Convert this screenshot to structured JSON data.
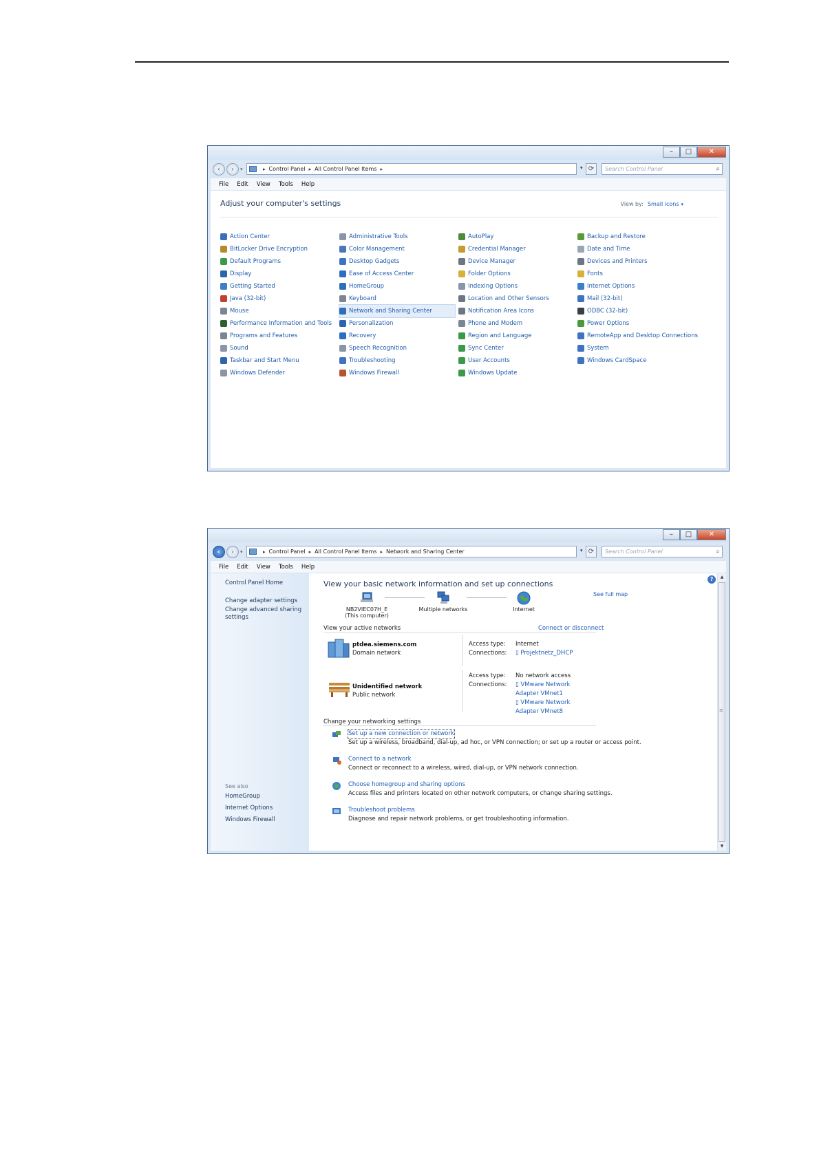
{
  "window1": {
    "title_buttons": [
      "–",
      "□",
      "✕"
    ],
    "nav": {
      "back": "‹",
      "forward": "›",
      "recent": "▾"
    },
    "breadcrumb": [
      "Control Panel",
      "All Control Panel Items"
    ],
    "breadcrumb_arrow": "▸",
    "addr_dropdown": "▾",
    "refresh": "⟳",
    "search_placeholder": "Search Control Panel",
    "search_glyph": "⌕",
    "menu": [
      "File",
      "Edit",
      "View",
      "Tools",
      "Help"
    ],
    "heading": "Adjust your computer's settings",
    "view_by_label": "View by:",
    "view_by_value": "Small icons",
    "view_by_caret": "▾",
    "items": [
      {
        "label": "Action Center",
        "icon": "flag-icon",
        "color": "#3b6fb6"
      },
      {
        "label": "Administrative Tools",
        "icon": "admin-tools-icon",
        "color": "#8a96a8"
      },
      {
        "label": "AutoPlay",
        "icon": "autoplay-icon",
        "color": "#4a8c3a"
      },
      {
        "label": "Backup and Restore",
        "icon": "backup-icon",
        "color": "#5a9a3c"
      },
      {
        "label": "BitLocker Drive Encryption",
        "icon": "bitlocker-icon",
        "color": "#b58a2c"
      },
      {
        "label": "Color Management",
        "icon": "color-management-icon",
        "color": "#4a78b5"
      },
      {
        "label": "Credential Manager",
        "icon": "credential-icon",
        "color": "#c69b2f"
      },
      {
        "label": "Date and Time",
        "icon": "clock-icon",
        "color": "#9aa6b5"
      },
      {
        "label": "Default Programs",
        "icon": "default-programs-icon",
        "color": "#3a9a4a"
      },
      {
        "label": "Desktop Gadgets",
        "icon": "gadgets-icon",
        "color": "#3d73c0"
      },
      {
        "label": "Device Manager",
        "icon": "device-manager-icon",
        "color": "#6d7784"
      },
      {
        "label": "Devices and Printers",
        "icon": "printer-icon",
        "color": "#6d7784"
      },
      {
        "label": "Display",
        "icon": "display-icon",
        "color": "#2d64b0"
      },
      {
        "label": "Ease of Access Center",
        "icon": "ease-of-access-icon",
        "color": "#2d6ec4"
      },
      {
        "label": "Folder Options",
        "icon": "folder-icon",
        "color": "#d8b13a"
      },
      {
        "label": "Fonts",
        "icon": "fonts-icon",
        "color": "#d8b13a"
      },
      {
        "label": "Getting Started",
        "icon": "getting-started-icon",
        "color": "#3d7fc9"
      },
      {
        "label": "HomeGroup",
        "icon": "homegroup-icon",
        "color": "#2e6fba"
      },
      {
        "label": "Indexing Options",
        "icon": "indexing-icon",
        "color": "#8a96a8"
      },
      {
        "label": "Internet Options",
        "icon": "internet-options-icon",
        "color": "#3a7fc8"
      },
      {
        "label": "Java (32-bit)",
        "icon": "java-icon",
        "color": "#c2412e"
      },
      {
        "label": "Keyboard",
        "icon": "keyboard-icon",
        "color": "#7b8593"
      },
      {
        "label": "Location and Other Sensors",
        "icon": "sensors-icon",
        "color": "#6d7784"
      },
      {
        "label": "Mail (32-bit)",
        "icon": "mail-icon",
        "color": "#3d73c0"
      },
      {
        "label": "Mouse",
        "icon": "mouse-icon",
        "color": "#7b8593"
      },
      {
        "label": "Network and Sharing Center",
        "icon": "network-icon",
        "color": "#2f6fb9"
      },
      {
        "label": "Notification Area Icons",
        "icon": "notification-icon",
        "color": "#6d7784"
      },
      {
        "label": "ODBC (32-bit)",
        "icon": "odbc-icon",
        "color": "#3a3f47"
      },
      {
        "label": "Performance Information and Tools",
        "icon": "performance-icon",
        "color": "#2e5f2e"
      },
      {
        "label": "Personalization",
        "icon": "personalization-icon",
        "color": "#2d64b0"
      },
      {
        "label": "Phone and Modem",
        "icon": "phone-icon",
        "color": "#7b8593"
      },
      {
        "label": "Power Options",
        "icon": "power-icon",
        "color": "#4a9a3c"
      },
      {
        "label": "Programs and Features",
        "icon": "programs-icon",
        "color": "#7b8593"
      },
      {
        "label": "Recovery",
        "icon": "recovery-icon",
        "color": "#2d6ec4"
      },
      {
        "label": "Region and Language",
        "icon": "region-icon",
        "color": "#3a9a4a"
      },
      {
        "label": "RemoteApp and Desktop Connections",
        "icon": "remoteapp-icon",
        "color": "#3d73c0"
      },
      {
        "label": "Sound",
        "icon": "speaker-icon",
        "color": "#8a96a8"
      },
      {
        "label": "Speech Recognition",
        "icon": "microphone-icon",
        "color": "#8a96a8"
      },
      {
        "label": "Sync Center",
        "icon": "sync-icon",
        "color": "#3a9a4a"
      },
      {
        "label": "System",
        "icon": "system-icon",
        "color": "#3d73c0"
      },
      {
        "label": "Taskbar and Start Menu",
        "icon": "taskbar-icon",
        "color": "#2d64b0"
      },
      {
        "label": "Troubleshooting",
        "icon": "troubleshooting-icon",
        "color": "#3d73c0"
      },
      {
        "label": "User Accounts",
        "icon": "user-accounts-icon",
        "color": "#3a9a4a"
      },
      {
        "label": "Windows CardSpace",
        "icon": "cardspace-icon",
        "color": "#3d73c0"
      },
      {
        "label": "Windows Defender",
        "icon": "defender-icon",
        "color": "#8a96a8"
      },
      {
        "label": "Windows Firewall",
        "icon": "firewall-icon",
        "color": "#b5552e"
      },
      {
        "label": "Windows Update",
        "icon": "windows-update-icon",
        "color": "#3a9a4a"
      }
    ],
    "highlighted_item": "Network and Sharing Center"
  },
  "window2": {
    "title_buttons": [
      "–",
      "□",
      "✕"
    ],
    "nav": {
      "back": "‹",
      "forward": "›",
      "recent": "▾"
    },
    "breadcrumb": [
      "Control Panel",
      "All Control Panel Items",
      "Network and Sharing Center"
    ],
    "breadcrumb_arrow": "▸",
    "addr_dropdown": "▾",
    "refresh": "⟳",
    "search_placeholder": "Search Control Panel",
    "search_glyph": "⌕",
    "menu": [
      "File",
      "Edit",
      "View",
      "Tools",
      "Help"
    ],
    "help_glyph": "?",
    "left_links": {
      "home": "Control Panel Home",
      "adapter": "Change adapter settings",
      "advanced": "Change advanced sharing settings"
    },
    "see_also": {
      "label": "See also",
      "links": [
        "HomeGroup",
        "Internet Options",
        "Windows Firewall"
      ]
    },
    "heading": "View your basic network information and set up connections",
    "see_full_map": "See full map",
    "map_nodes": {
      "computer_name": "NB2VIEC07H_E",
      "computer_sub": "(This computer)",
      "middle": "Multiple networks",
      "internet": "Internet"
    },
    "active_header": "View your active networks",
    "connect_link": "Connect or disconnect",
    "networks": [
      {
        "name": "ptdea.siemens.com",
        "type": "Domain network",
        "access_label": "Access type:",
        "access_value": "Internet",
        "connections_label": "Connections:",
        "connections": [
          "Projektnetz_DHCP"
        ]
      },
      {
        "name": "Unidentified network",
        "type": "Public network",
        "access_label": "Access type:",
        "access_value": "No network access",
        "connections_label": "Connections:",
        "connections": [
          "VMware Network Adapter VMnet1",
          "VMware Network Adapter VMnet8"
        ]
      }
    ],
    "change_header": "Change your networking settings",
    "tasks": [
      {
        "title": "Set up a new connection or network",
        "desc": "Set up a wireless, broadband, dial-up, ad hoc, or VPN connection; or set up a router or access point."
      },
      {
        "title": "Connect to a network",
        "desc": "Connect or reconnect to a wireless, wired, dial-up, or VPN network connection."
      },
      {
        "title": "Choose homegroup and sharing options",
        "desc": "Access files and printers located on other network computers, or change sharing settings."
      },
      {
        "title": "Troubleshoot problems",
        "desc": "Diagnose and repair network problems, or get troubleshooting information."
      }
    ],
    "scroll": {
      "up": "▲",
      "down": "▼",
      "grip": "≡"
    }
  }
}
